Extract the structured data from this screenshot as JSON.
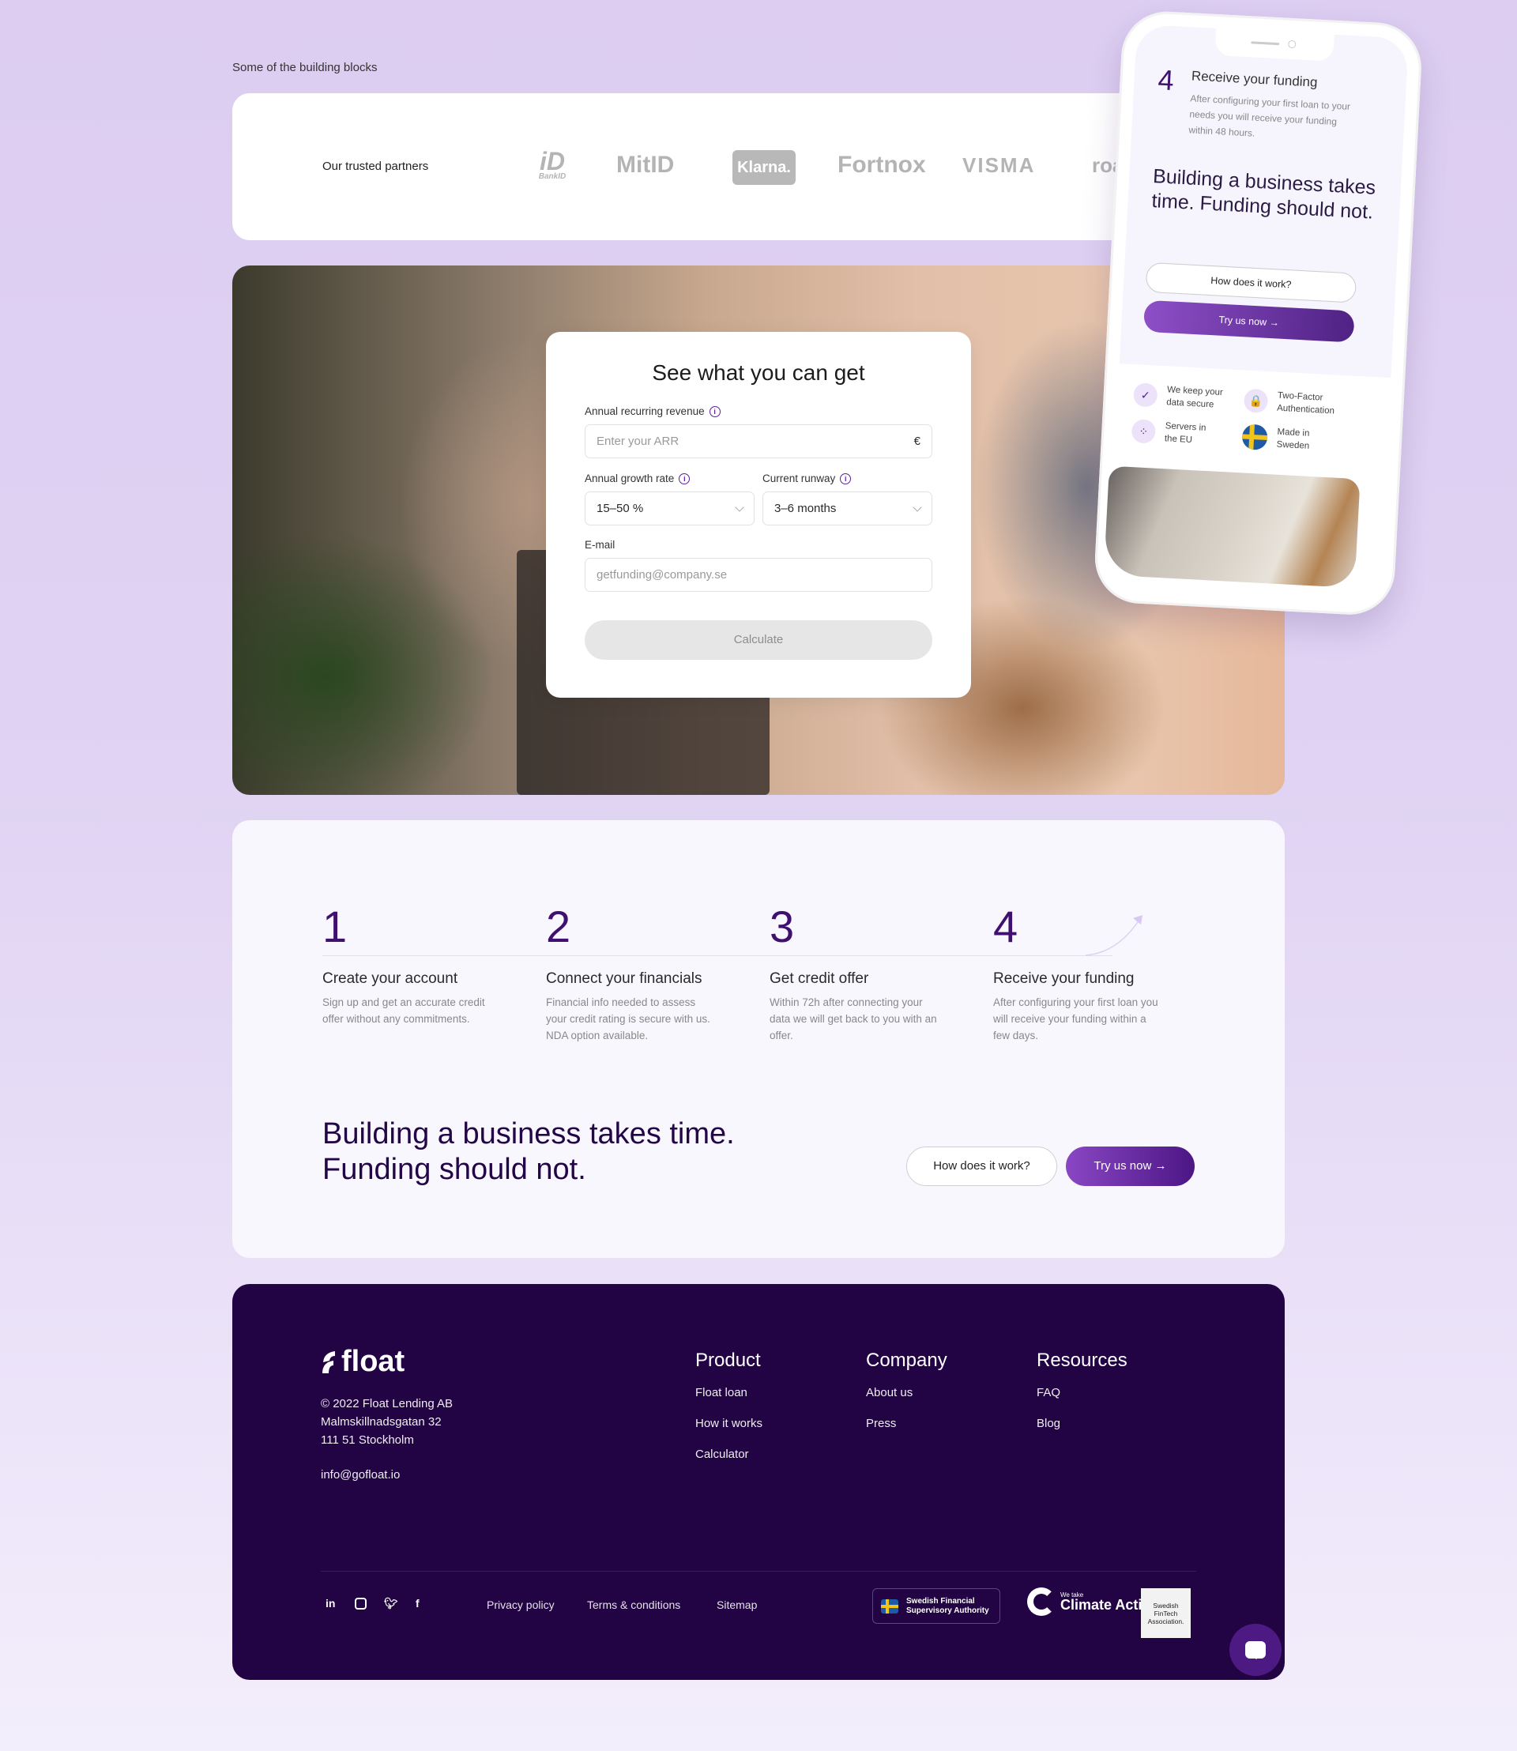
{
  "section_label": "Some of the building blocks",
  "partners": {
    "label": "Our trusted partners",
    "logos": [
      "BankID",
      "MitID",
      "Klarna.",
      "Fortnox",
      "VISMA",
      "roa"
    ]
  },
  "form": {
    "title": "See what you can get",
    "arr_label": "Annual recurring revenue",
    "arr_placeholder": "Enter your ARR",
    "arr_currency": "€",
    "growth_label": "Annual growth rate",
    "growth_value": "15–50 %",
    "runway_label": "Current runway",
    "runway_value": "3–6 months",
    "email_label": "E-mail",
    "email_placeholder": "getfunding@company.se",
    "calculate_label": "Calculate"
  },
  "phone": {
    "step_number": "4",
    "step_title": "Receive your funding",
    "step_desc": "After configuring your first loan to your needs you will receive your funding within 48 hours.",
    "headline": "Building a business takes time. Funding should not.",
    "how_label": "How does it work?",
    "try_label": "Try us now →",
    "trust": [
      {
        "icon": "shield-check-icon",
        "text": "We keep your data secure"
      },
      {
        "icon": "lock-icon",
        "text": "Two-Factor Authentication"
      },
      {
        "icon": "eu-stars-icon",
        "text": "Servers in the EU"
      },
      {
        "icon": "sweden-flag-icon",
        "text": "Made in Sweden"
      }
    ]
  },
  "steps": [
    {
      "number": "1",
      "title": "Create your account",
      "desc": "Sign up and get an accurate credit offer without any commitments."
    },
    {
      "number": "2",
      "title": "Connect your financials",
      "desc": "Financial info needed to assess your credit rating is secure with us. NDA option available."
    },
    {
      "number": "3",
      "title": "Get credit offer",
      "desc": "Within 72h after connecting your data we will get back to you with an offer."
    },
    {
      "number": "4",
      "title": "Receive your funding",
      "desc": "After configuring your first loan you will receive your funding within a few days."
    }
  ],
  "cta": {
    "headline_line1": "Building a business takes time.",
    "headline_line2": "Funding should not.",
    "how_label": "How does it work?",
    "try_label": "Try us now →"
  },
  "footer": {
    "logo": "float",
    "address": [
      "© 2022 Float Lending AB",
      "Malmskillnadsgatan 32",
      "111 51 Stockholm"
    ],
    "email": "info@gofloat.io",
    "columns": [
      {
        "title": "Product",
        "links": [
          "Float loan",
          "How it works",
          "Calculator"
        ]
      },
      {
        "title": "Company",
        "links": [
          "About us",
          "Press"
        ]
      },
      {
        "title": "Resources",
        "links": [
          "FAQ",
          "Blog"
        ]
      }
    ],
    "social": [
      "in",
      "instagram",
      "twitter",
      "f"
    ],
    "legal": [
      "Privacy policy",
      "Terms & conditions",
      "Sitemap"
    ],
    "badges": {
      "fsa": "Swedish Financial Supervisory Authority",
      "climate_small": "We take",
      "climate_big": "Climate Action",
      "sfa": "Swedish FinTech Association."
    }
  },
  "colors": {
    "brand": "#40106f",
    "footer_bg": "#220344",
    "accent": "#8a47c4"
  }
}
